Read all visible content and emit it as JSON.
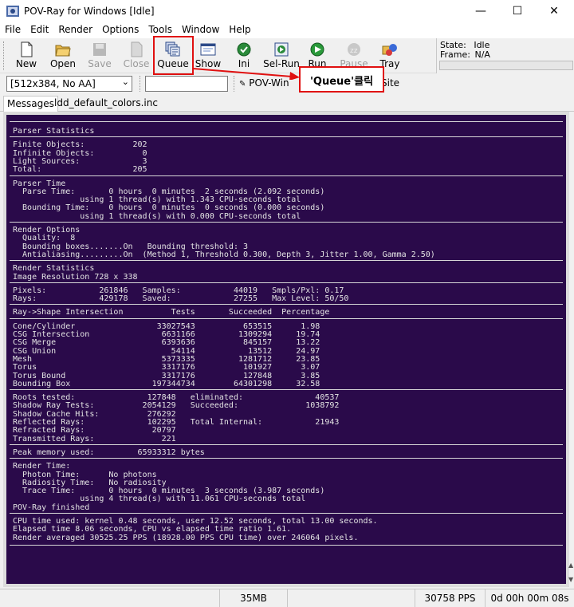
{
  "window": {
    "title": "POV-Ray for Windows [Idle]",
    "controls": [
      "—",
      "☐",
      "✕"
    ]
  },
  "menu": [
    "File",
    "Edit",
    "Render",
    "Options",
    "Tools",
    "Window",
    "Help"
  ],
  "toolbar": {
    "buttons": [
      {
        "label": "New",
        "icon": "new-file-icon",
        "enabled": true
      },
      {
        "label": "Open",
        "icon": "open-folder-icon",
        "enabled": true
      },
      {
        "label": "Save",
        "icon": "save-icon",
        "enabled": false
      },
      {
        "label": "Close",
        "icon": "close-document-icon",
        "enabled": false
      },
      {
        "label": "Queue",
        "icon": "queue-icon",
        "enabled": true
      },
      {
        "label": "Show",
        "icon": "show-window-icon",
        "enabled": true
      },
      {
        "label": "Ini",
        "icon": "ini-icon",
        "enabled": true
      },
      {
        "label": "Sel-Run",
        "icon": "select-run-icon",
        "enabled": true
      },
      {
        "label": "Run",
        "icon": "run-icon",
        "enabled": true
      },
      {
        "label": "Pause",
        "icon": "pause-icon",
        "enabled": false
      },
      {
        "label": "Tray",
        "icon": "tray-icon",
        "enabled": true
      }
    ]
  },
  "state_panel": {
    "state_label": "State:",
    "state_value": "Idle",
    "frame_label": "Frame:",
    "frame_value": "N/A"
  },
  "toolbar2": {
    "resolution": "[512x384, No AA]",
    "command_value": "",
    "povwin_label": "POV-Win",
    "site_label": "Site"
  },
  "tabs": [
    {
      "label": "Messages",
      "active": true
    },
    {
      "label": "ldd_default_colors.inc",
      "active": false
    }
  ],
  "console": {
    "background": "#2a0a4a",
    "lines": [
      "Parser Statistics",
      "",
      "Finite Objects:          202",
      "Infinite Objects:          0",
      "Light Sources:             3",
      "Total:                   205",
      "",
      "Parser Time",
      "  Parse Time:       0 hours  0 minutes  2 seconds (2.092 seconds)",
      "              using 1 thread(s) with 1.343 CPU-seconds total",
      "  Bounding Time:    0 hours  0 minutes  0 seconds (0.000 seconds)",
      "              using 1 thread(s) with 0.000 CPU-seconds total",
      "",
      "Render Options",
      "  Quality:  8",
      "  Bounding boxes.......On   Bounding threshold: 3",
      "  Antialiasing.........On  (Method 1, Threshold 0.300, Depth 3, Jitter 1.00, Gamma 2.50)",
      "",
      "Render Statistics",
      "Image Resolution 728 x 338",
      "",
      "Pixels:           261846   Samples:           44019   Smpls/Pxl: 0.17",
      "Rays:             429178   Saved:             27255   Max Level: 50/50",
      "",
      "Ray->Shape Intersection          Tests       Succeeded  Percentage",
      "",
      "Cone/Cylinder                 33027543          653515      1.98",
      "CSG Intersection               6631166         1309294     19.74",
      "CSG Merge                      6393636          845157     13.22",
      "CSG Union                        54114           13512     24.97",
      "Mesh                           5373335         1281712     23.85",
      "Torus                          3317176          101927      3.07",
      "Torus Bound                    3317176          127848      3.85",
      "Bounding Box                 197344734        64301298     32.58",
      "",
      "Roots tested:               127848   eliminated:               40537",
      "Shadow Ray Tests:          2054129   Succeeded:              1038792",
      "Shadow Cache Hits:          276292",
      "Reflected Rays:             102295   Total Internal:           21943",
      "Refracted Rays:              20797",
      "Transmitted Rays:              221",
      "",
      "Peak memory used:         65933312 bytes",
      "",
      "Render Time:",
      "  Photon Time:      No photons",
      "  Radiosity Time:   No radiosity",
      "  Trace Time:       0 hours  0 minutes  3 seconds (3.987 seconds)",
      "              using 4 thread(s) with 11.061 CPU-seconds total",
      "POV-Ray finished",
      "",
      "CPU time used: kernel 0.48 seconds, user 12.52 seconds, total 13.00 seconds.",
      "Elapsed time 8.06 seconds, CPU vs elapsed time ratio 1.61.",
      "Render averaged 30525.25 PPS (18928.00 PPS CPU time) over 246064 pixels."
    ]
  },
  "statusbar": {
    "memory": "35MB",
    "pps": "30758 PPS",
    "elapsed": "0d 00h 00m 08s"
  },
  "annotation": {
    "callout_text": "'Queue'클릭",
    "color": "#e01010"
  }
}
